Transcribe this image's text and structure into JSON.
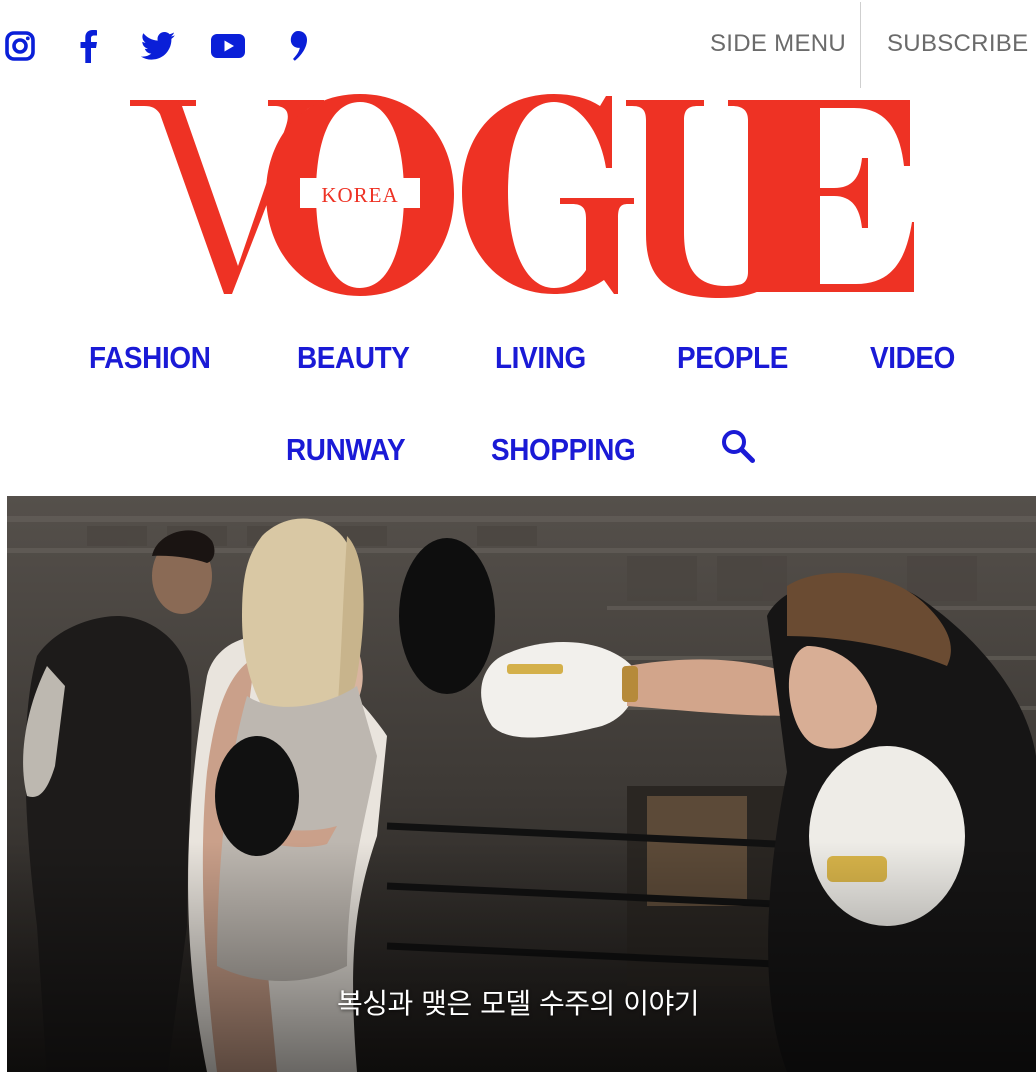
{
  "header": {
    "social": [
      {
        "name": "instagram-icon"
      },
      {
        "name": "facebook-icon"
      },
      {
        "name": "twitter-icon"
      },
      {
        "name": "youtube-icon"
      },
      {
        "name": "comma-icon"
      }
    ],
    "side_menu_label": "SIDE MENU",
    "subscribe_label": "SUBSCRIBE",
    "link_color": "#6b6b6b",
    "icon_color": "#0a1fd8"
  },
  "logo": {
    "wordmark": "VOGUE",
    "edition": "KOREA",
    "color": "#ee3224"
  },
  "nav": {
    "row1": [
      "FASHION",
      "BEAUTY",
      "LIVING",
      "PEOPLE",
      "VIDEO"
    ],
    "row2": [
      "RUNWAY",
      "SHOPPING"
    ],
    "search_icon": "search-icon",
    "color": "#1a1ad6"
  },
  "hero": {
    "caption": "복싱과 맺은 모델 수주의 이야기"
  }
}
